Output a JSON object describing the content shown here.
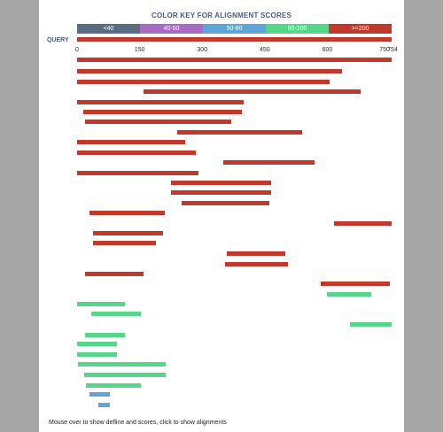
{
  "key": {
    "title": "COLOR KEY FOR ALIGNMENT SCORES",
    "segments": [
      {
        "label": "<40",
        "color": "#5a6c82"
      },
      {
        "label": "40-50",
        "color": "#a66cc4"
      },
      {
        "label": "50-80",
        "color": "#5ba8d8"
      },
      {
        "label": "80-200",
        "color": "#55d68a"
      },
      {
        "label": ">=200",
        "color": "#c0392b"
      }
    ]
  },
  "query": {
    "label": "QUERY",
    "length": 754,
    "ticks": [
      "0",
      "150",
      "300",
      "450",
      "600",
      "750",
      "754"
    ]
  },
  "hits": [
    {
      "start": 0,
      "end": 754,
      "color": "#c0392b"
    },
    {
      "start": 0,
      "end": 635,
      "color": "#c0392b"
    },
    {
      "start": 0,
      "end": 605,
      "color": "#c0392b"
    },
    {
      "start": 160,
      "end": 680,
      "color": "#c0392b"
    },
    {
      "start": 0,
      "end": 400,
      "color": "#c0392b"
    },
    {
      "start": 15,
      "end": 395,
      "color": "#c0392b"
    },
    {
      "start": 20,
      "end": 370,
      "color": "#c0392b"
    },
    {
      "start": 240,
      "end": 540,
      "color": "#c0392b"
    },
    {
      "start": 0,
      "end": 260,
      "color": "#c0392b"
    },
    {
      "start": 0,
      "end": 285,
      "color": "#c0392b"
    },
    {
      "start": 350,
      "end": 570,
      "color": "#c0392b"
    },
    {
      "start": 0,
      "end": 290,
      "color": "#c0392b"
    },
    {
      "start": 225,
      "end": 465,
      "color": "#c0392b"
    },
    {
      "start": 225,
      "end": 465,
      "color": "#c0392b"
    },
    {
      "start": 250,
      "end": 460,
      "color": "#c0392b"
    },
    {
      "start": 30,
      "end": 210,
      "color": "#c0392b"
    },
    {
      "start": 615,
      "end": 754,
      "color": "#c0392b"
    },
    {
      "start": 38,
      "end": 205,
      "color": "#c0392b"
    },
    {
      "start": 38,
      "end": 190,
      "color": "#c0392b"
    },
    {
      "start": 360,
      "end": 500,
      "color": "#c0392b"
    },
    {
      "start": 355,
      "end": 505,
      "color": "#c0392b"
    },
    {
      "start": 20,
      "end": 160,
      "color": "#c0392b"
    },
    {
      "start": 585,
      "end": 750,
      "color": "#c0392b"
    },
    {
      "start": 600,
      "end": 705,
      "color": "#55d68a"
    },
    {
      "start": 0,
      "end": 115,
      "color": "#55d68a"
    },
    {
      "start": 35,
      "end": 153,
      "color": "#55d68a"
    },
    {
      "start": 655,
      "end": 754,
      "color": "#55d68a"
    },
    {
      "start": 20,
      "end": 115,
      "color": "#55d68a"
    },
    {
      "start": 0,
      "end": 95,
      "color": "#55d68a"
    },
    {
      "start": 0,
      "end": 95,
      "color": "#55d68a"
    },
    {
      "start": 2,
      "end": 213,
      "color": "#55d68a"
    },
    {
      "start": 18,
      "end": 213,
      "color": "#55d68a"
    },
    {
      "start": 22,
      "end": 153,
      "color": "#55d68a"
    },
    {
      "start": 30,
      "end": 78,
      "color": "#5ba8d8"
    },
    {
      "start": 50,
      "end": 78,
      "color": "#5ba8d8"
    }
  ],
  "footer": "Mouse over to show defline and scores, click to show alignments"
}
